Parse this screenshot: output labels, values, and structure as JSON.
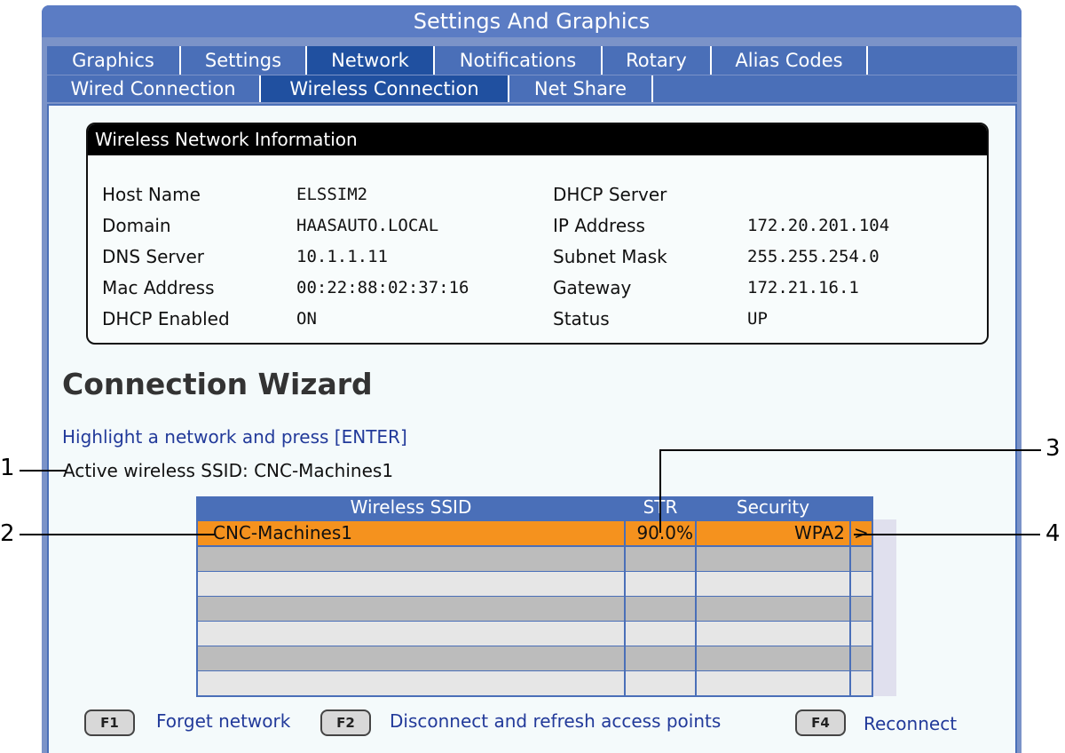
{
  "window": {
    "title": "Settings And Graphics"
  },
  "tabs_top": [
    {
      "label": "Graphics"
    },
    {
      "label": "Settings"
    },
    {
      "label": "Network"
    },
    {
      "label": "Notifications"
    },
    {
      "label": "Rotary"
    },
    {
      "label": "Alias Codes"
    }
  ],
  "tabs_sub": [
    {
      "label": "Wired Connection"
    },
    {
      "label": "Wireless Connection"
    },
    {
      "label": "Net Share"
    }
  ],
  "info": {
    "header": "Wireless Network Information",
    "left": [
      {
        "label": "Host Name",
        "value": "ELSSIM2"
      },
      {
        "label": "Domain",
        "value": "HAASAUTO.LOCAL"
      },
      {
        "label": "DNS Server",
        "value": "10.1.1.11"
      },
      {
        "label": "Mac Address",
        "value": "00:22:88:02:37:16"
      },
      {
        "label": "DHCP Enabled",
        "value": "ON"
      }
    ],
    "right": [
      {
        "label": "DHCP Server",
        "value": ""
      },
      {
        "label": "IP Address",
        "value": "172.20.201.104"
      },
      {
        "label": "Subnet Mask",
        "value": "255.255.254.0"
      },
      {
        "label": "Gateway",
        "value": "172.21.16.1"
      },
      {
        "label": "Status",
        "value": "UP"
      }
    ]
  },
  "wizard": {
    "title": "Connection Wizard",
    "instruction": "Highlight a network and press [ENTER]",
    "active_ssid": "Active wireless SSID: CNC-Machines1"
  },
  "table": {
    "headers": [
      "Wireless SSID",
      "STR",
      "Security"
    ],
    "rows": [
      {
        "ssid": "CNC-Machines1",
        "str": "90.0%",
        "security": "WPA2",
        "arrow": ">"
      }
    ]
  },
  "callouts": [
    "1",
    "2",
    "3",
    "4"
  ],
  "fkeys": [
    {
      "key": "F1",
      "label": "Forget network"
    },
    {
      "key": "F2",
      "label": "Disconnect and refresh access points"
    },
    {
      "key": "F4",
      "label": "Reconnect"
    }
  ],
  "colors": {
    "title_bar": "#5b7cc4",
    "tab": "#4a6fb8",
    "tab_active": "#2050a0",
    "selected_row": "#f5921e",
    "link_text": "#223a9a"
  }
}
